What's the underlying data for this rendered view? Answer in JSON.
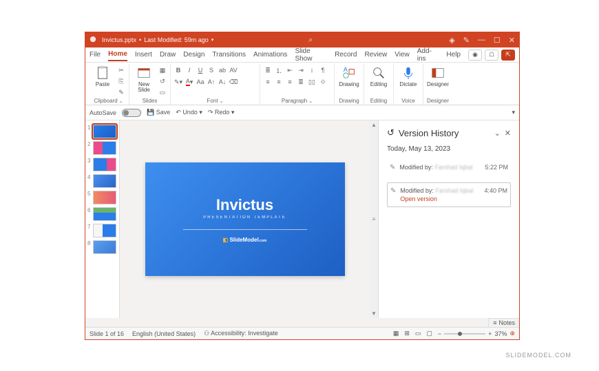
{
  "titlebar": {
    "filename": "Invictus.pptx",
    "modified": "Last Modified: 59m ago"
  },
  "tabs": [
    "File",
    "Home",
    "Insert",
    "Draw",
    "Design",
    "Transitions",
    "Animations",
    "Slide Show",
    "Record",
    "Review",
    "View",
    "Add-ins",
    "Help"
  ],
  "ribbon": {
    "clipboard": {
      "label": "Clipboard",
      "paste": "Paste"
    },
    "slides": {
      "label": "Slides",
      "new": "New\nSlide"
    },
    "font": {
      "label": "Font"
    },
    "paragraph": {
      "label": "Paragraph"
    },
    "drawing": {
      "label": "Drawing",
      "btn": "Drawing"
    },
    "editing": {
      "label": "Editing",
      "btn": "Editing"
    },
    "voice": {
      "label": "Voice",
      "btn": "Dictate"
    },
    "designer": {
      "label": "Designer",
      "btn": "Designer"
    }
  },
  "qat": {
    "autosave": "AutoSave",
    "save": "Save",
    "undo": "Undo",
    "redo": "Redo"
  },
  "slide": {
    "title": "Invictus",
    "subtitle": "PRESENTATION TEMPLATE",
    "logo_text": "SlideModel"
  },
  "thumbs": [
    1,
    2,
    3,
    4,
    5,
    6,
    7,
    8
  ],
  "panel": {
    "title": "Version History",
    "date": "Today, May 13, 2023",
    "entries": [
      {
        "prefix": "Modified by:",
        "author": "Farshad Iqbal",
        "time": "5:22 PM",
        "open": false
      },
      {
        "prefix": "Modified by:",
        "author": "Farshad Iqbal",
        "time": "4:40 PM",
        "open": true
      }
    ],
    "open_label": "Open version"
  },
  "status": {
    "slide": "Slide 1 of 16",
    "lang": "English (United States)",
    "access": "Accessibility: Investigate",
    "notes": "Notes",
    "zoom": "37%"
  },
  "watermark": "SLIDEMODEL.COM"
}
